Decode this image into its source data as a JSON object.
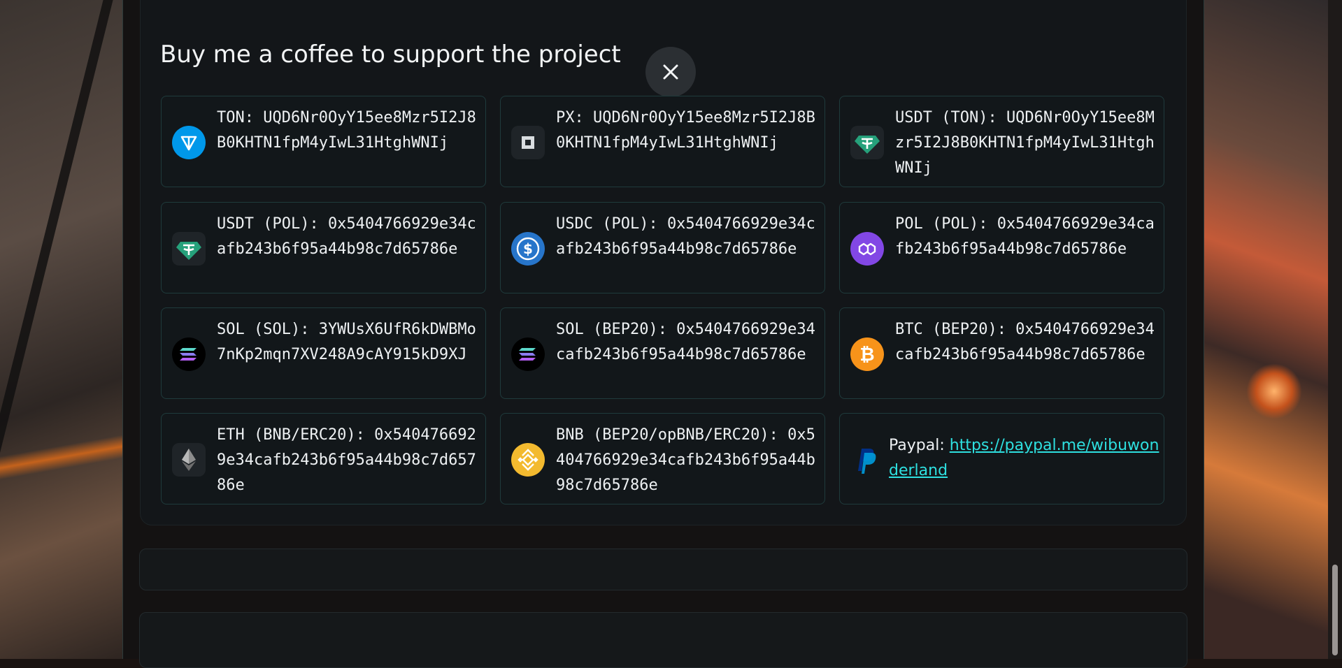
{
  "modal": {
    "title": "Buy me a coffee to support the project",
    "close_icon": "close-icon"
  },
  "wallets": [
    {
      "icon": "ton-icon",
      "color": "#0098ea",
      "text": "TON: UQD6Nr0OyY15ee8Mzr5I2J8B0KHTN1fpM4yIwL31HtghWNIj"
    },
    {
      "icon": "px-icon",
      "color": "#2a2e33",
      "text": "PX: UQD6Nr0OyY15ee8Mzr5I2J8B0KHTN1fpM4yIwL31HtghWNIj"
    },
    {
      "icon": "usdt-icon",
      "color": "#26a17b",
      "text": "USDT (TON): UQD6Nr0OyY15ee8Mzr5I2J8B0KHTN1fpM4yIwL31HtghWNIj"
    },
    {
      "icon": "usdt-icon",
      "color": "#26a17b",
      "text": "USDT (POL): 0x5404766929e34cafb243b6f95a44b98c7d65786e"
    },
    {
      "icon": "usdc-icon",
      "color": "#2775ca",
      "text": "USDC (POL): 0x5404766929e34cafb243b6f95a44b98c7d65786e"
    },
    {
      "icon": "polygon-icon",
      "color": "#8247e5",
      "text": "POL (POL): 0x5404766929e34cafb243b6f95a44b98c7d65786e"
    },
    {
      "icon": "solana-icon",
      "color": "#000000",
      "text": "SOL (SOL): 3YWUsX6UfR6kDWBMo7nKp2mqn7XV248A9cAY915kD9XJ"
    },
    {
      "icon": "solana-icon",
      "color": "#000000",
      "text": "SOL (BEP20): 0x5404766929e34cafb243b6f95a44b98c7d65786e"
    },
    {
      "icon": "bitcoin-icon",
      "color": "#f7931a",
      "text": "BTC (BEP20): 0x5404766929e34cafb243b6f95a44b98c7d65786e"
    },
    {
      "icon": "ethereum-icon",
      "color": "#3c3c3d",
      "text": "ETH (BNB/ERC20): 0x5404766929e34cafb243b6f95a44b98c7d65786e"
    },
    {
      "icon": "bnb-icon",
      "color": "#f3ba2f",
      "text": "BNB (BEP20/opBNB/ERC20): 0x5404766929e34cafb243b6f95a44b98c7d65786e"
    }
  ],
  "paypal": {
    "icon": "paypal-icon",
    "label": "Paypal: ",
    "link": "https://paypal.me/wibuwonderland"
  }
}
